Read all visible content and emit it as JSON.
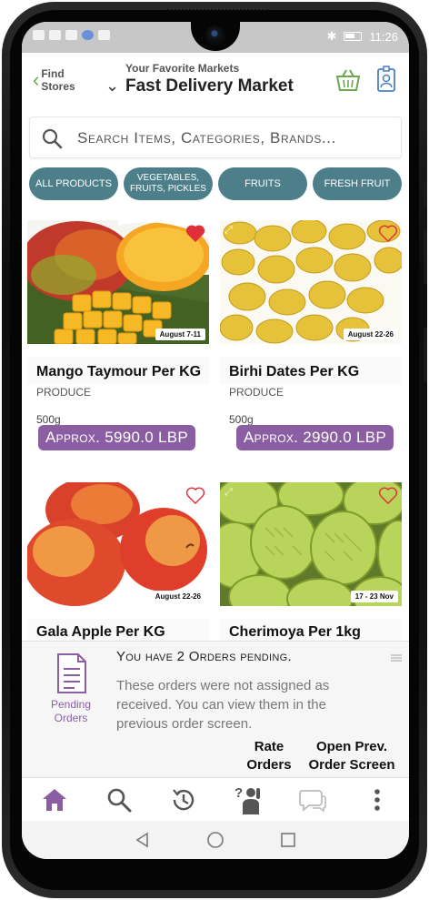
{
  "status_bar": {
    "time": "11:26"
  },
  "header": {
    "back_label": "Find Stores",
    "subtitle": "Your Favorite Markets",
    "title": "Fast Delivery Market"
  },
  "search": {
    "placeholder": "Search Items, Categories, Brands..."
  },
  "categories": [
    {
      "label": "ALL PRODUCTS"
    },
    {
      "label": "VEGETABLES, FRUITS, PICKLES"
    },
    {
      "label": "FRUITS"
    },
    {
      "label": "FRESH FRUIT"
    }
  ],
  "products": [
    {
      "name": "Mango Taymour Per KG",
      "category": "PRODUCE",
      "weight": "500g",
      "price": "Approx. 5990.0 LBP",
      "date": "August 7-11",
      "favorited": true
    },
    {
      "name": "Birhi Dates Per KG",
      "category": "PRODUCE",
      "weight": "500g",
      "price": "Approx. 2990.0 LBP",
      "date": "August 22-26",
      "favorited": false
    },
    {
      "name": "Gala Apple Per KG",
      "category": "",
      "weight": "",
      "price": "",
      "date": "August 22-26",
      "favorited": false
    },
    {
      "name": "Cherimoya Per 1kg",
      "category": "",
      "weight": "",
      "price": "",
      "date": "17 - 23 Nov",
      "favorited": false
    }
  ],
  "pending": {
    "icon_label": "Pending Orders",
    "title": "You have 2 Orders pending.",
    "body": "These orders were not assigned as received. You can view them in the previous order screen.",
    "rate_button": "Rate Orders",
    "open_button": "Open Prev. Order Screen"
  },
  "colors": {
    "accent": "#8b5ea3",
    "chip": "#4d7f8a",
    "heart": "#e0303a",
    "back": "#6aa84f"
  }
}
